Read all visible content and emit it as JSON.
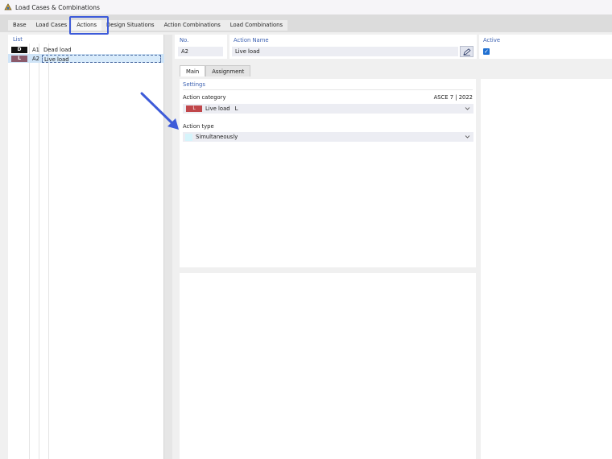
{
  "window": {
    "title": "Load Cases & Combinations"
  },
  "tabs": [
    {
      "label": "Base"
    },
    {
      "label": "Load Cases"
    },
    {
      "label": "Actions",
      "active": true
    },
    {
      "label": "Design Situations"
    },
    {
      "label": "Action Combinations"
    },
    {
      "label": "Load Combinations"
    }
  ],
  "list": {
    "header": "List",
    "items": [
      {
        "badge": "D",
        "badge_color": "#111111",
        "id": "A1",
        "name": "Dead load"
      },
      {
        "badge": "L",
        "badge_color": "#8a5a6b",
        "id": "A2",
        "name": "Live load",
        "selected": true
      }
    ]
  },
  "detail": {
    "no_label": "No.",
    "no_value": "A2",
    "name_label": "Action Name",
    "name_value": "Live load",
    "active_label": "Active",
    "active_checked": true
  },
  "subtabs": [
    {
      "label": "Main",
      "active": true
    },
    {
      "label": "Assignment"
    }
  ],
  "main": {
    "settings_title": "Settings",
    "category_label": "Action category",
    "category_standard": "ASCE 7 | 2022",
    "category_badge": "L",
    "category_badge_color": "#c0464a",
    "category_value": "Live load",
    "category_code": "L",
    "type_label": "Action type",
    "type_value": "Simultaneously"
  },
  "colors": {
    "accent": "#3a5fb0",
    "highlight": "#3d5bd9",
    "checkbox": "#1f6fd1"
  }
}
